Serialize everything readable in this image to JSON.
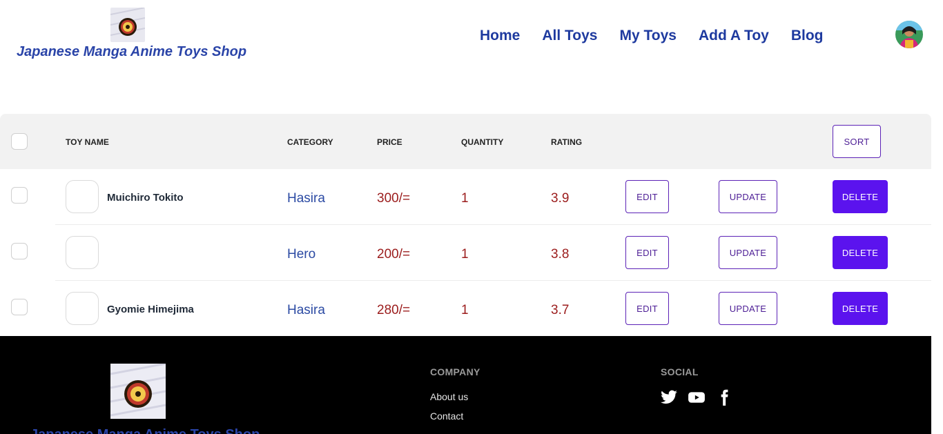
{
  "header": {
    "brand_title": "Japanese Manga Anime Toys Shop",
    "nav": [
      "Home",
      "All Toys",
      "My Toys",
      "Add A Toy",
      "Blog"
    ]
  },
  "table": {
    "columns": {
      "toy_name": "TOY NAME",
      "category": "CATEGORY",
      "price": "PRICE",
      "quantity": "QUANTITY",
      "rating": "RATING"
    },
    "sort_label": "SORT",
    "rows": [
      {
        "name": "Muichiro Tokito",
        "category": "Hasira",
        "price": "300/=",
        "quantity": "1",
        "rating": "3.9"
      },
      {
        "name": "",
        "category": "Hero",
        "price": "200/=",
        "quantity": "1",
        "rating": "3.8"
      },
      {
        "name": "Gyomie Himejima",
        "category": "Hasira",
        "price": "280/=",
        "quantity": "1",
        "rating": "3.7"
      }
    ],
    "edit_label": "EDIT",
    "update_label": "UPDATE",
    "delete_label": "DELETE"
  },
  "footer": {
    "brand_title": "Japanese Manga Anime Toys Shop",
    "company_heading": "COMPANY",
    "company_links": [
      "About us",
      "Contact"
    ],
    "social_heading": "SOCIAL",
    "social_icons": [
      "twitter-icon",
      "youtube-icon",
      "facebook-icon"
    ]
  },
  "colors": {
    "nav": "#1e3a9f",
    "category": "#2b4aa3",
    "value": "#9b1c1c",
    "accent": "#5b13ee"
  }
}
